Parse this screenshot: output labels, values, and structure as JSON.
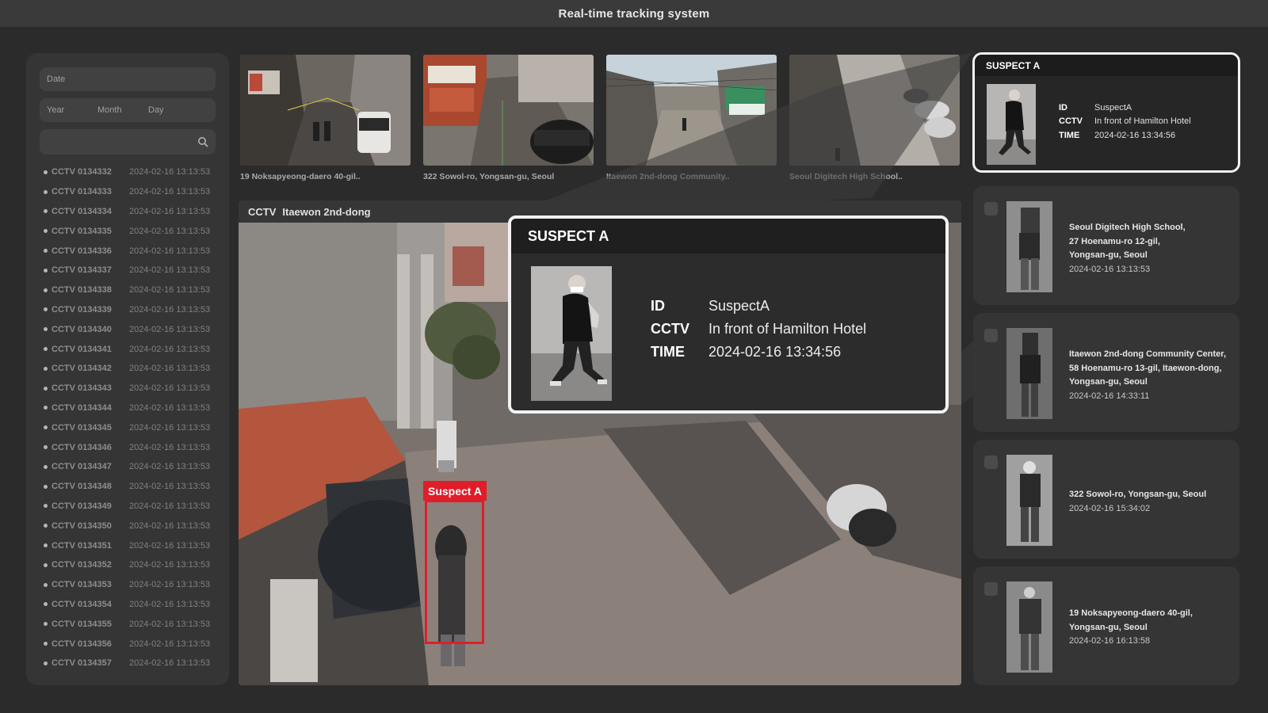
{
  "app": {
    "title": "Real-time tracking system"
  },
  "filters": {
    "date_label": "Date",
    "year_label": "Year",
    "month_label": "Month",
    "day_label": "Day",
    "search_icon": "search-icon"
  },
  "cctv_list": [
    {
      "id": "CCTV 0134332",
      "time": "2024-02-16 13:13:53"
    },
    {
      "id": "CCTV 0134333",
      "time": "2024-02-16 13:13:53"
    },
    {
      "id": "CCTV 0134334",
      "time": "2024-02-16 13:13:53"
    },
    {
      "id": "CCTV 0134335",
      "time": "2024-02-16 13:13:53"
    },
    {
      "id": "CCTV 0134336",
      "time": "2024-02-16 13:13:53"
    },
    {
      "id": "CCTV 0134337",
      "time": "2024-02-16 13:13:53"
    },
    {
      "id": "CCTV 0134338",
      "time": "2024-02-16 13:13:53"
    },
    {
      "id": "CCTV 0134339",
      "time": "2024-02-16 13:13:53"
    },
    {
      "id": "CCTV 0134340",
      "time": "2024-02-16 13:13:53"
    },
    {
      "id": "CCTV 0134341",
      "time": "2024-02-16 13:13:53"
    },
    {
      "id": "CCTV 0134342",
      "time": "2024-02-16 13:13:53"
    },
    {
      "id": "CCTV 0134343",
      "time": "2024-02-16 13:13:53"
    },
    {
      "id": "CCTV 0134344",
      "time": "2024-02-16 13:13:53"
    },
    {
      "id": "CCTV 0134345",
      "time": "2024-02-16 13:13:53"
    },
    {
      "id": "CCTV 0134346",
      "time": "2024-02-16 13:13:53"
    },
    {
      "id": "CCTV 0134347",
      "time": "2024-02-16 13:13:53"
    },
    {
      "id": "CCTV 0134348",
      "time": "2024-02-16 13:13:53"
    },
    {
      "id": "CCTV 0134349",
      "time": "2024-02-16 13:13:53"
    },
    {
      "id": "CCTV 0134350",
      "time": "2024-02-16 13:13:53"
    },
    {
      "id": "CCTV 0134351",
      "time": "2024-02-16 13:13:53"
    },
    {
      "id": "CCTV 0134352",
      "time": "2024-02-16 13:13:53"
    },
    {
      "id": "CCTV 0134353",
      "time": "2024-02-16 13:13:53"
    },
    {
      "id": "CCTV 0134354",
      "time": "2024-02-16 13:13:53"
    },
    {
      "id": "CCTV 0134355",
      "time": "2024-02-16 13:13:53"
    },
    {
      "id": "CCTV 0134356",
      "time": "2024-02-16 13:13:53"
    },
    {
      "id": "CCTV 0134357",
      "time": "2024-02-16 13:13:53"
    }
  ],
  "thumbnails": [
    {
      "caption": "19 Noksapyeong-daero 40-gil.."
    },
    {
      "caption": "322 Sowol-ro, Yongsan-gu, Seoul"
    },
    {
      "caption": "Itaewon 2nd-dong Community.."
    },
    {
      "caption": "Seoul Digitech High School.."
    }
  ],
  "main_video": {
    "cctv_label": "CCTV",
    "camera_name": "Itaewon 2nd-dong",
    "detection_label": "Suspect A"
  },
  "popup": {
    "title": "SUSPECT A",
    "id_key": "ID",
    "id_value": "SuspectA",
    "cctv_key": "CCTV",
    "cctv_value": "In front of Hamilton Hotel",
    "time_key": "TIME",
    "time_value": "2024-02-16 13:34:56"
  },
  "suspect_card": {
    "title": "SUSPECT A",
    "id_key": "ID",
    "id_value": "SuspectA",
    "cctv_key": "CCTV",
    "cctv_value": "In front of Hamilton Hotel",
    "time_key": "TIME",
    "time_value": "2024-02-16 13:34:56"
  },
  "sightings": [
    {
      "location_lines": [
        "Seoul Digitech High School,",
        "27 Hoenamu-ro 12-gil,",
        "Yongsan-gu, Seoul"
      ],
      "time": "2024-02-16 13:13:53"
    },
    {
      "location_lines": [
        "Itaewon 2nd-dong Community Center,",
        "58 Hoenamu-ro 13-gil, Itaewon-dong,",
        "Yongsan-gu, Seoul"
      ],
      "time": "2024-02-16 14:33:11"
    },
    {
      "location_lines": [
        "322 Sowol-ro, Yongsan-gu, Seoul"
      ],
      "time": "2024-02-16 15:34:02"
    },
    {
      "location_lines": [
        "19 Noksapyeong-daero 40-gil,",
        "Yongsan-gu, Seoul"
      ],
      "time": "2024-02-16 16:13:58"
    }
  ],
  "colors": {
    "background": "#2b2b2b",
    "panel": "#353535",
    "accent_red": "#e11d2a",
    "highlight_border": "#f2f2f2"
  }
}
